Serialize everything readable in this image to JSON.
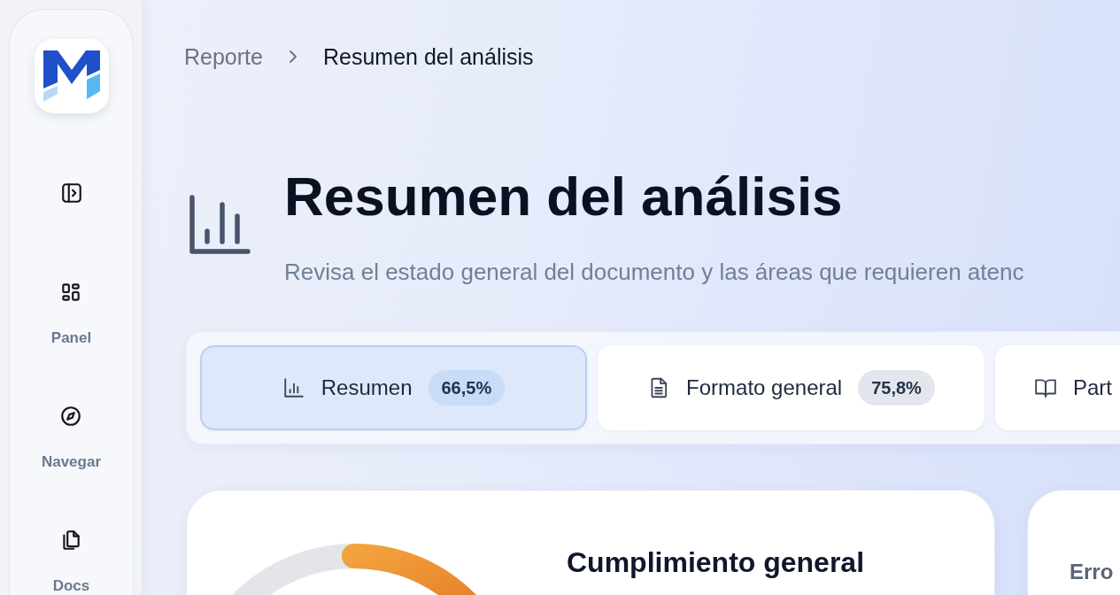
{
  "sidebar": {
    "nav_items": [
      {
        "label": "Panel"
      },
      {
        "label": "Navegar"
      },
      {
        "label": "Docs"
      }
    ]
  },
  "breadcrumb": {
    "items": [
      {
        "label": "Reporte"
      },
      {
        "label": "Resumen del análisis"
      }
    ]
  },
  "header": {
    "title": "Resumen del análisis",
    "subtitle": "Revisa el estado general del documento y las áreas que requieren atenc"
  },
  "tabs": [
    {
      "label": "Resumen",
      "badge": "66,5%",
      "selected": true
    },
    {
      "label": "Formato general",
      "badge": "75,8%",
      "selected": false
    },
    {
      "label": "Part",
      "selected": false
    }
  ],
  "summary_cards": [
    {
      "kind": "gauge",
      "title": "Cumplimiento general",
      "level": 0.665
    },
    {
      "kind": "metric",
      "label": "Erro"
    }
  ]
}
